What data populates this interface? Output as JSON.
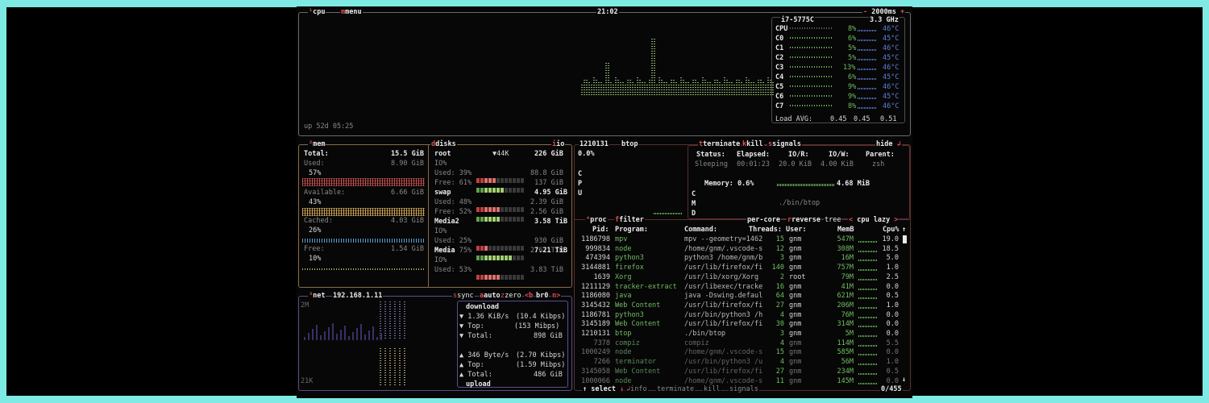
{
  "cpu": {
    "tab1": "cpu",
    "tab2": "menu",
    "clock": "21:02",
    "interval": "2000ms",
    "model": "i7-5775C",
    "freq": "3.3 GHz",
    "uptime": "up 52d 05:25",
    "cores": [
      {
        "name": "CPU",
        "pct": "8%",
        "temp": "46°C"
      },
      {
        "name": "C0",
        "pct": "6%",
        "temp": "45°C"
      },
      {
        "name": "C1",
        "pct": "5%",
        "temp": "46°C"
      },
      {
        "name": "C2",
        "pct": "5%",
        "temp": "45°C"
      },
      {
        "name": "C3",
        "pct": "13%",
        "temp": "46°C"
      },
      {
        "name": "C4",
        "pct": "6%",
        "temp": "45°C"
      },
      {
        "name": "C5",
        "pct": "9%",
        "temp": "46°C"
      },
      {
        "name": "C6",
        "pct": "9%",
        "temp": "45°C"
      },
      {
        "name": "C7",
        "pct": "8%",
        "temp": "46°C"
      }
    ],
    "load_label": "Load AVG:",
    "load": [
      "0.45",
      "0.45",
      "0.51"
    ]
  },
  "mem": {
    "tab": "mem",
    "disks_tab": "disks",
    "io_tab": "io",
    "total_label": "Total:",
    "total": "15.5 GiB",
    "used_label": "Used:",
    "used": "8.90 GiB",
    "used_pct": "57%",
    "avail_label": "Available:",
    "avail": "6.66 GiB",
    "avail_pct": "43%",
    "cached_label": "Cached:",
    "cached": "4.03 GiB",
    "cached_pct": "26%",
    "free_label": "Free:",
    "free": "1.54 GiB",
    "free_pct": "10%"
  },
  "disks": [
    {
      "name": "root",
      "io_speed": "▼44K",
      "size": "226 GiB",
      "io": "IO%",
      "used": "Used: 39%",
      "used_v": "88.8 GiB",
      "free": "Free: 61%",
      "free_v": "137 GiB",
      "used_frac": 0.39
    },
    {
      "name": "swap",
      "io_speed": "",
      "size": "4.95 GiB",
      "io": "",
      "used": "Used: 48%",
      "used_v": "2.39 GiB",
      "free": "Free: 52%",
      "free_v": "2.56 GiB",
      "used_frac": 0.48
    },
    {
      "name": "Media2",
      "io_speed": "",
      "size": "3.58 TiB",
      "io": "IO%",
      "used": "Used: 25%",
      "used_v": "930 GiB",
      "free": "Free: 75%",
      "free_v": "2.67 TiB",
      "used_frac": 0.25
    },
    {
      "name": "Media",
      "io_speed": "",
      "size": "7.21 TiB",
      "io": "IO%",
      "used": "Used: 53%",
      "used_v": "3.83 TiB",
      "free": "",
      "free_v": "",
      "used_frac": 0.53
    }
  ],
  "net": {
    "tab": "net",
    "ip": "192.168.1.11",
    "sync": "sync",
    "auto": "auto",
    "zero": "zero",
    "iface_prev": "<b",
    "iface": "br0",
    "iface_next": "n>",
    "scale_top": "2M",
    "scale_bottom": "21K",
    "download": "download",
    "dl_rate": "1.36 KiB/s",
    "dl_bits": "(10.4 Kibps)",
    "dl_top_label": "Top:",
    "dl_top": "(153 Mibps)",
    "dl_total_label": "Total:",
    "dl_total": "898 GiB",
    "ul_rate": "346 Byte/s",
    "ul_bits": "(2.70 Kibps)",
    "ul_top_label": "Top:",
    "ul_top": "(1.59 Mibps)",
    "ul_total_label": "Total:",
    "ul_total": "486 GiB",
    "upload": "upload"
  },
  "proc": {
    "pid": "1210131",
    "name": "btop",
    "cpu_pct": "0.0%",
    "terminate": "terminate",
    "kill": "kill",
    "signals": "signals",
    "hide": "hide",
    "status_label": "Status:",
    "status": "Sleeping",
    "elapsed_label": "Elapsed:",
    "elapsed": "00:01:23",
    "ior_label": "IO/R:",
    "ior": "20.0 KiB",
    "iow_label": "IO/W:",
    "iow": "4.00 KiB",
    "parent_label": "Parent:",
    "parent": "zsh",
    "memory_label": "Memory: 0.6%",
    "memory": "4.68 MiB",
    "cmd": "./bin/btop",
    "cpu_letters": [
      "C",
      "P",
      "U"
    ],
    "mem_letters": [
      "C",
      "M",
      "D"
    ],
    "tabs": {
      "proc": "proc",
      "filter": "filter",
      "per_core": "per-core",
      "reverse": "reverse",
      "tree": "tree",
      "sort": "cpu lazy"
    },
    "cols": {
      "pid": "Pid:",
      "program": "Program:",
      "command": "Command:",
      "threads": "Threads:",
      "user": "User:",
      "mem": "MemB",
      "cpu": "Cpu%"
    },
    "rows": [
      {
        "pid": "1186798",
        "prog": "mpv",
        "cmd": "mpv --geometry=1462",
        "thr": "15",
        "user": "gnm",
        "mem": "547M",
        "cpu": "19.0"
      },
      {
        "pid": "999834",
        "prog": "node",
        "cmd": "/home/gnm/.vscode-s",
        "thr": "12",
        "user": "gnm",
        "mem": "308M",
        "cpu": "18.5"
      },
      {
        "pid": "474394",
        "prog": "python3",
        "cmd": "python3 /home/gnm/b",
        "thr": "3",
        "user": "gnm",
        "mem": "16M",
        "cpu": "5.0"
      },
      {
        "pid": "3144881",
        "prog": "firefox",
        "cmd": "/usr/lib/firefox/fi",
        "thr": "140",
        "user": "gnm",
        "mem": "757M",
        "cpu": "1.0"
      },
      {
        "pid": "1639",
        "prog": "Xorg",
        "cmd": "/usr/lib/xorg/Xorg",
        "thr": "2",
        "user": "root",
        "mem": "79M",
        "cpu": "2.5"
      },
      {
        "pid": "1211129",
        "prog": "tracker-extract",
        "cmd": "/usr/libexec/tracke",
        "thr": "16",
        "user": "gnm",
        "mem": "41M",
        "cpu": "0.0"
      },
      {
        "pid": "1186080",
        "prog": "java",
        "cmd": "java -Dswing.defaul",
        "thr": "64",
        "user": "gnm",
        "mem": "621M",
        "cpu": "0.5"
      },
      {
        "pid": "3145432",
        "prog": "Web Content",
        "cmd": "/usr/lib/firefox/fi",
        "thr": "27",
        "user": "gnm",
        "mem": "206M",
        "cpu": "1.0"
      },
      {
        "pid": "1186781",
        "prog": "python3",
        "cmd": "/usr/bin/python3 /h",
        "thr": "4",
        "user": "gnm",
        "mem": "76M",
        "cpu": "0.0"
      },
      {
        "pid": "3145189",
        "prog": "Web Content",
        "cmd": "/usr/lib/firefox/fi",
        "thr": "30",
        "user": "gnm",
        "mem": "314M",
        "cpu": "0.0"
      },
      {
        "pid": "1210131",
        "prog": "btop",
        "cmd": "./bin/btop",
        "thr": "3",
        "user": "gnm",
        "mem": "5M",
        "cpu": "0.0"
      },
      {
        "pid": "7378",
        "prog": "compiz",
        "cmd": "compiz",
        "thr": "4",
        "user": "gnm",
        "mem": "114M",
        "cpu": "5.5"
      },
      {
        "pid": "1000249",
        "prog": "node",
        "cmd": "/home/gnm/.vscode-s",
        "thr": "15",
        "user": "gnm",
        "mem": "585M",
        "cpu": "0.0"
      },
      {
        "pid": "7266",
        "prog": "terminator",
        "cmd": "/usr/bin/python3 /u",
        "thr": "4",
        "user": "gnm",
        "mem": "56M",
        "cpu": "1.0"
      },
      {
        "pid": "3145058",
        "prog": "Web Content",
        "cmd": "/usr/lib/firefox/fi",
        "thr": "27",
        "user": "gnm",
        "mem": "234M",
        "cpu": "0.5"
      },
      {
        "pid": "1000066",
        "prog": "node",
        "cmd": "/home/gnm/.vscode-s",
        "thr": "11",
        "user": "gnm",
        "mem": "145M",
        "cpu": "0.0"
      }
    ],
    "footer": {
      "select": "select",
      "info": "info",
      "terminate": "terminate",
      "kill": "kill",
      "signals": "signals",
      "count": "0/455"
    }
  }
}
